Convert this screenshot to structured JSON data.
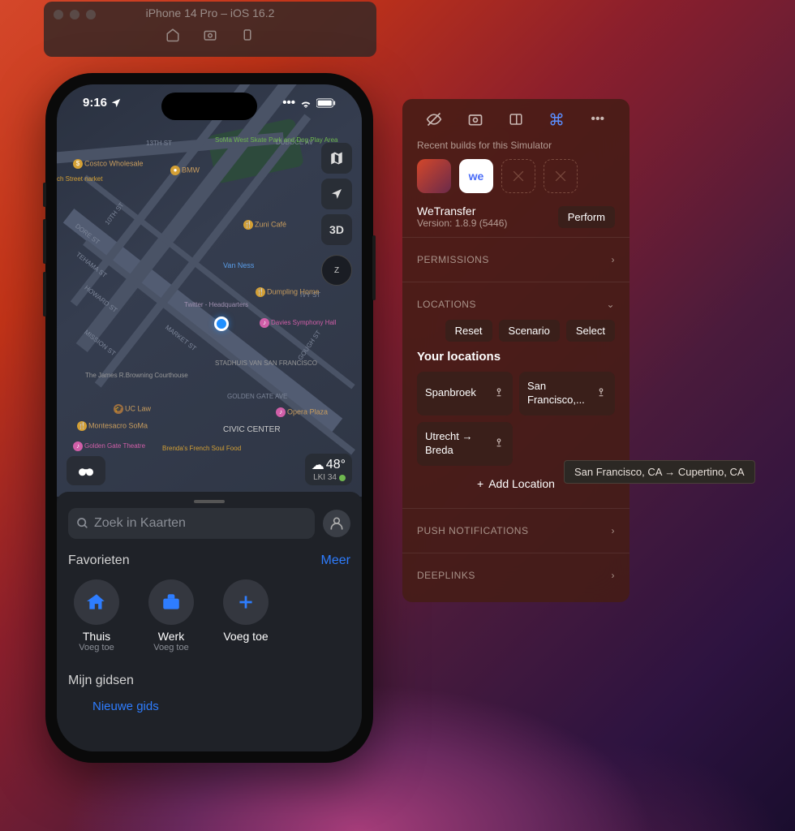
{
  "simulator": {
    "title": "iPhone 14 Pro – iOS 16.2"
  },
  "statusBar": {
    "time": "9:16"
  },
  "map": {
    "pois": {
      "costco": "Costco Wholesale",
      "bmw": "BMW",
      "skatepark": "SoMa West Skate Park and Dog Play Area",
      "chstreet": "ch Street narket",
      "zuni": "Zuni Café",
      "vanness": "Van Ness",
      "dumpling": "Dumpling Home",
      "twitter": "Twitter - Headquarters",
      "davies": "Davies Symphony Hall",
      "stadhuis": "STADHUIS VAN SAN FRANCISCO",
      "jamesbrowning": "The James R.Browning Courthouse",
      "uclaw": "UC Law",
      "opera": "Opera Plaza",
      "montesacro": "Montesacro SoMa",
      "civiccenter": "CIVIC CENTER",
      "goldengate": "Golden Gate Theatre",
      "brendas": "Brenda's French Soul Food"
    },
    "streets": {
      "s13th": "13TH ST",
      "duboce": "DUBOCE AV",
      "s10th": "10TH ST",
      "dore": "DORE ST",
      "tehama": "TEHAMA ST",
      "howard": "HOWARD ST",
      "mission": "MISSION ST",
      "market": "MARKET ST",
      "gough": "GOUGH ST",
      "goldengate": "GOLDEN GATE AVE",
      "ivy": "IVY ST"
    },
    "controls": {
      "threeD": "3D",
      "compass": "Z"
    },
    "weather": {
      "temp": "48°",
      "aqi": "LKI 34"
    }
  },
  "sheet": {
    "searchPlaceholder": "Zoek in Kaarten",
    "favoritesTitle": "Favorieten",
    "moreLink": "Meer",
    "favorites": {
      "home": {
        "label": "Thuis",
        "sub": "Voeg toe"
      },
      "work": {
        "label": "Werk",
        "sub": "Voeg toe"
      },
      "add": {
        "label": "Voeg toe",
        "sub": ""
      }
    },
    "guidesTitle": "Mijn gidsen",
    "newGuide": "Nieuwe gids"
  },
  "inspector": {
    "recentBuildsLabel": "Recent builds for this Simulator",
    "selectedBuildLabel": "we",
    "app": {
      "name": "WeTransfer",
      "version": "Version: 1.8.9 (5446)"
    },
    "performLabel": "Perform",
    "permissions": "PERMISSIONS",
    "locations": "LOCATIONS",
    "actions": {
      "reset": "Reset",
      "scenario": "Scenario",
      "select": "Select"
    },
    "yourLocationsTitle": "Your locations",
    "locationCards": {
      "spanbroek": "Spanbroek",
      "sf": "San Francisco,...",
      "utrecht": "Utrecht → Breda"
    },
    "addLocation": "Add Location",
    "pushNotifications": "PUSH NOTIFICATIONS",
    "deeplinks": "DEEPLINKS"
  },
  "tooltip": "San Francisco, CA → Cupertino, CA"
}
